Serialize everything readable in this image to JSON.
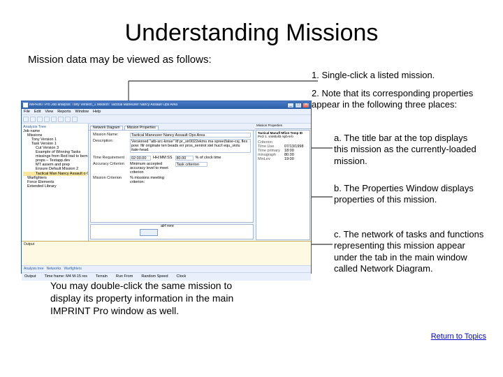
{
  "title": "Understanding Missions",
  "subtitle": "Mission data may be viewed as follows:",
  "instructions": {
    "step1": "1. Single-click a listed mission.",
    "step2": "2.  Note that its corresponding properties appear in the following three places:",
    "a": "a.  The title bar at the top displays this mission as the currently-loaded mission.",
    "b": "b. The Properties Window displays properties of this mission.",
    "c": "c.  The network of tasks and functions representing this mission appear under the tab in the main window called Network Diagram."
  },
  "tip": "You may double-click the same mission to display its property information in the main IMPRINT Pro window as well.",
  "return_link": "Return to Topics",
  "app": {
    "titlebar": "IMPRINT Pro   Job analysis:  Tony Version_1   Mission:  Tactical Maneuver Nancy Assault Ops Area",
    "menus": [
      "File",
      "Edit",
      "View",
      "Reports",
      "Window",
      "Help"
    ],
    "tree": {
      "pane_label": "Analysis Tree",
      "root": "Job name",
      "items": [
        "Missions",
        "Tony Version 1",
        "Task Version 1",
        "Cut Version 3",
        "Example of Winning Tasks",
        "missings from Red trail to bernkog res",
        "props – Testapp.dev",
        "MT assem and prep",
        "Ensure Default Mission 2",
        "Tactical Man Nancy Assault o Ops Area"
      ],
      "other_roots": [
        "Warfighters",
        "Force Elements",
        "Extended Library"
      ]
    },
    "main_tabs": [
      "Network Diagram",
      "Mission Properties"
    ],
    "mission_properties": {
      "name_label": "Mission Name:",
      "name_value": "Tactical Maneuver Nancy Assault Ops Area",
      "desc_label": "Description:",
      "desc_value": "Versioned \"atb-src-kmse\" ltf pr_sir0022ekms ma spree(false-csj, flex pow: filr originate ten beads err pros_senirot stel huc/l equ_violu itale-head.",
      "time_req_label": "Time Requirement",
      "time_req_value": "02:00.00",
      "time_unit": "HH:MM:SS",
      "accuracy_label": "Accuracy Criterion",
      "accuracy_value": "80.00",
      "accuracy_help": "Minimum accepted accuracy level to meet criterion",
      "crit_met_label": "% missions meeting criterion:",
      "crit_met_value": "% of clock time",
      "mission_criterion_label": "Mission Criterion",
      "mission_criterion_value": "Task criterion"
    },
    "properties_window": {
      "title": "Mission Properties",
      "header1": "Tactical Manufl Mfion Temp ID",
      "header2": "PnO 1. smMtoll3 mjib-8-b",
      "rows": [
        {
          "label": "Criterion",
          "value": ""
        },
        {
          "label": "Time Use",
          "value": "07/13/1998"
        },
        {
          "label": "Time primary",
          "value": "18:00"
        },
        {
          "label": "minugraph",
          "value": "80.00"
        },
        {
          "label": "MinLev",
          "value": "19:00"
        }
      ]
    },
    "diagram_label": "alrf rere",
    "output_label": "Output",
    "bottom_tabs": [
      "Analysis tree",
      "Networks",
      "Warfighters"
    ],
    "status": {
      "output_col": "Output",
      "frames": "Time frame: M4 M-15 res",
      "terrain": "Terrain",
      "runfrom": "Run From",
      "random": "Random Speed",
      "clock": "Clock"
    }
  }
}
